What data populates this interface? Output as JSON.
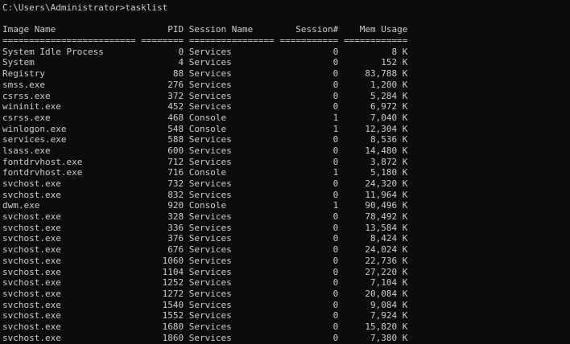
{
  "terminal": {
    "prompt": "C:\\Users\\Administrator>tasklist",
    "colors": {
      "background": "#0c0c0c",
      "foreground": "#cccccc"
    }
  },
  "table": {
    "header": "Image Name                     PID Session Name        Session#    Mem Usage",
    "separator": "========================= ======== ================ =========== ============",
    "rows": [
      "System Idle Process              0 Services                   0          8 K",
      "System                           4 Services                   0        152 K",
      "Registry                        88 Services                   0     83,788 K",
      "smss.exe                       276 Services                   0      1,200 K",
      "csrss.exe                      372 Services                   0      5,284 K",
      "wininit.exe                    452 Services                   0      6,972 K",
      "csrss.exe                      468 Console                    1      7,040 K",
      "winlogon.exe                   548 Console                    1     12,304 K",
      "services.exe                   588 Services                   0      8,536 K",
      "lsass.exe                      600 Services                   0     14,480 K",
      "fontdrvhost.exe                712 Services                   0      3,872 K",
      "fontdrvhost.exe                716 Console                    1      5,180 K",
      "svchost.exe                    732 Services                   0     24,320 K",
      "svchost.exe                    832 Services                   0     11,964 K",
      "dwm.exe                        920 Console                    1     90,496 K",
      "svchost.exe                    328 Services                   0     78,492 K",
      "svchost.exe                    336 Services                   0     13,584 K",
      "svchost.exe                    376 Services                   0      8,424 K",
      "svchost.exe                    676 Services                   0     24,024 K",
      "svchost.exe                   1060 Services                   0     22,736 K",
      "svchost.exe                   1104 Services                   0     27,220 K",
      "svchost.exe                   1252 Services                   0      7,104 K",
      "svchost.exe                   1272 Services                   0     20,084 K",
      "svchost.exe                   1540 Services                   0      9,084 K",
      "svchost.exe                   1552 Services                   0      7,924 K",
      "svchost.exe                   1680 Services                   0     15,820 K",
      "svchost.exe                   1860 Services                   0      7,380 K"
    ]
  }
}
